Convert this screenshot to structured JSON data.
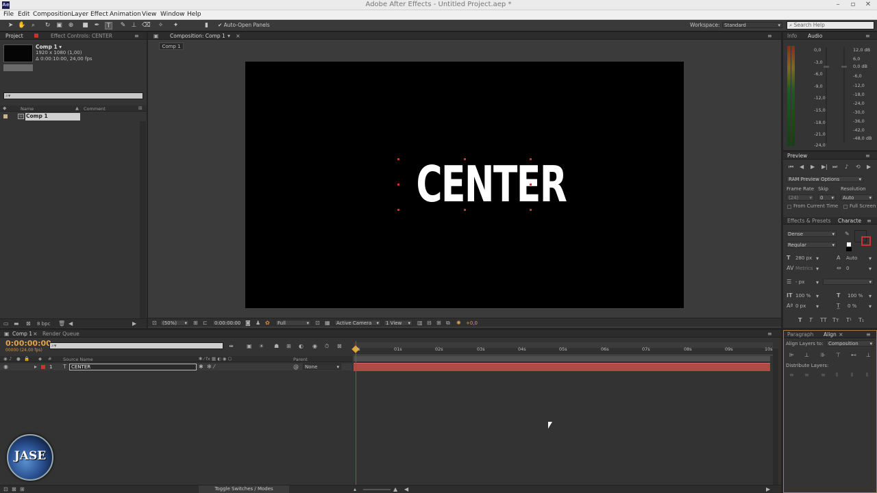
{
  "window": {
    "title": "Adobe After Effects - Untitled Project.aep *",
    "app_icon": "Ae",
    "controls": [
      "–",
      "▫",
      "✕"
    ]
  },
  "menu": [
    "File",
    "Edit",
    "Composition",
    "Layer",
    "Effect",
    "Animation",
    "View",
    "Window",
    "Help"
  ],
  "toolbar": {
    "auto_open": "Auto-Open Panels",
    "workspace_label": "Workspace:",
    "workspace_value": "Standard",
    "search_placeholder": "Search Help"
  },
  "project_panel": {
    "tabs": [
      "Project",
      "Effect Controls: CENTER"
    ],
    "comp_name": "Comp 1 ▾",
    "comp_size": "1920 x 1080 (1,00)",
    "comp_duration": "Δ 0:00:10:00, 24,00 fps",
    "search_placeholder": "⌕▾",
    "columns": [
      "Name",
      "Comment"
    ],
    "items": [
      {
        "name": "Comp 1"
      }
    ],
    "footer_bpc": "8 bpc"
  },
  "composition_panel": {
    "tab": "Composition: Comp 1",
    "breadcrumb": "Comp 1",
    "canvas_text": "CENTER",
    "footer": {
      "zoom": "(50%)",
      "timecode": "0:00:00:00",
      "resolution": "Full",
      "camera": "Active Camera",
      "views": "1 View",
      "exposure": "+0,0"
    }
  },
  "info_audio": {
    "tabs": [
      "Info",
      "Audio"
    ],
    "db_left": [
      "0,0",
      "-3,0",
      "-6,0",
      "-9,0",
      "-12,0",
      "-15,0",
      "-18,0",
      "-21,0",
      "-24,0"
    ],
    "db_right": [
      "12,0 dB",
      "6,0",
      "0,0 dB",
      "-6,0",
      "-12,0",
      "-18,0",
      "-24,0",
      "-30,0",
      "-36,0",
      "-42,0",
      "-48,0 dB"
    ]
  },
  "preview": {
    "tab": "Preview",
    "ram_options": "RAM Preview Options",
    "frame_rate_label": "Frame Rate",
    "skip_label": "Skip",
    "resolution_label": "Resolution",
    "frame_rate": "(24)",
    "skip": "0",
    "resolution": "Auto",
    "from_current": "From Current Time",
    "full_screen": "Full Screen"
  },
  "character": {
    "tabs": [
      "Effects & Presets",
      "Characte"
    ],
    "font": "Dense",
    "style": "Regular",
    "size": "280 px",
    "leading": "Auto",
    "kerning": "Metrics",
    "tracking": "0",
    "stroke": "- px",
    "vscale": "100 %",
    "hscale": "100 %",
    "baseline": "0 px",
    "tsume": "0 %",
    "fill_color": "#ffffff"
  },
  "timeline": {
    "tabs": [
      "Comp 1",
      "Render Queue"
    ],
    "timecode": "0:00:00:00",
    "fps": "00000 (24.00 fps)",
    "columns": {
      "source": "Source Name",
      "parent": "Parent"
    },
    "layers": [
      {
        "num": "1",
        "name": "CENTER",
        "parent": "None"
      }
    ],
    "ticks": [
      "0s",
      "01s",
      "02s",
      "03s",
      "04s",
      "05s",
      "06s",
      "07s",
      "08s",
      "09s",
      "10s"
    ],
    "toggle_label": "Toggle Switches / Modes",
    "bar_color": "#b04a44"
  },
  "align": {
    "tabs": [
      "Paragraph",
      "Align"
    ],
    "align_to_label": "Align Layers to:",
    "align_to_value": "Composition",
    "distribute_label": "Distribute Layers:"
  },
  "watermark": {
    "text": "JASE"
  }
}
